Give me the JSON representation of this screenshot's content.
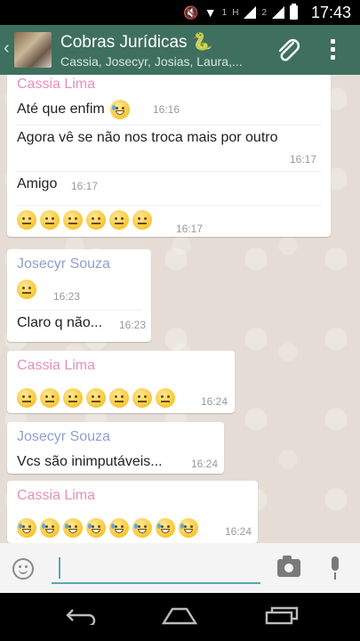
{
  "status_bar": {
    "time": "17:43",
    "sim1": "1",
    "h": "H",
    "sim2": "2"
  },
  "header": {
    "title": "Cobras Jurídicas 🐍",
    "participants": "Cassia, Josecyr, Josias, Laura,..."
  },
  "messages": [
    {
      "sender": "Cassia Lima",
      "sender_color": "#e58fb8",
      "lines": [
        {
          "text": "Até que enfim",
          "emoji": [
            "laugh"
          ],
          "time": "16:16"
        },
        {
          "text": "Agora vê se não nos troca mais por outro",
          "time": "16:17"
        },
        {
          "text": "Amigo",
          "time": "16:17"
        },
        {
          "text": "",
          "emoji": [
            "neutral",
            "neutral",
            "neutral",
            "neutral",
            "neutral",
            "neutral"
          ],
          "time": "16:17"
        }
      ]
    },
    {
      "sender": "Josecyr Souza",
      "sender_color": "#8f9fd0",
      "lines": [
        {
          "text": "",
          "emoji": [
            "unamused"
          ],
          "time": "16:23"
        },
        {
          "text": "Claro q não...",
          "time": "16:23"
        }
      ]
    },
    {
      "sender": "Cassia Lima",
      "sender_color": "#e58fb8",
      "lines": [
        {
          "text": "",
          "emoji": [
            "unamused",
            "unamused",
            "unamused",
            "unamused",
            "unamused",
            "unamused",
            "unamused"
          ],
          "time": "16:24"
        }
      ]
    },
    {
      "sender": "Josecyr Souza",
      "sender_color": "#8f9fd0",
      "lines": [
        {
          "text": "Vcs são inimputáveis...",
          "time": "16:24"
        }
      ]
    },
    {
      "sender": "Cassia Lima",
      "sender_color": "#e58fb8",
      "lines": [
        {
          "text": "",
          "emoji": [
            "laugh",
            "laugh",
            "laugh",
            "laugh",
            "laugh",
            "laugh",
            "laugh",
            "laugh"
          ],
          "time": "16:24"
        }
      ]
    }
  ],
  "input": {
    "placeholder": ""
  },
  "icons": {
    "back": "back-icon",
    "attach": "paperclip-icon",
    "menu": "overflow-menu-icon",
    "emoji": "smiley-icon",
    "camera": "camera-icon",
    "mic": "microphone-icon"
  },
  "colors": {
    "header": "#3e6f5f",
    "chat_bg": "#e5ddd5",
    "accent": "#5aa6b8"
  }
}
